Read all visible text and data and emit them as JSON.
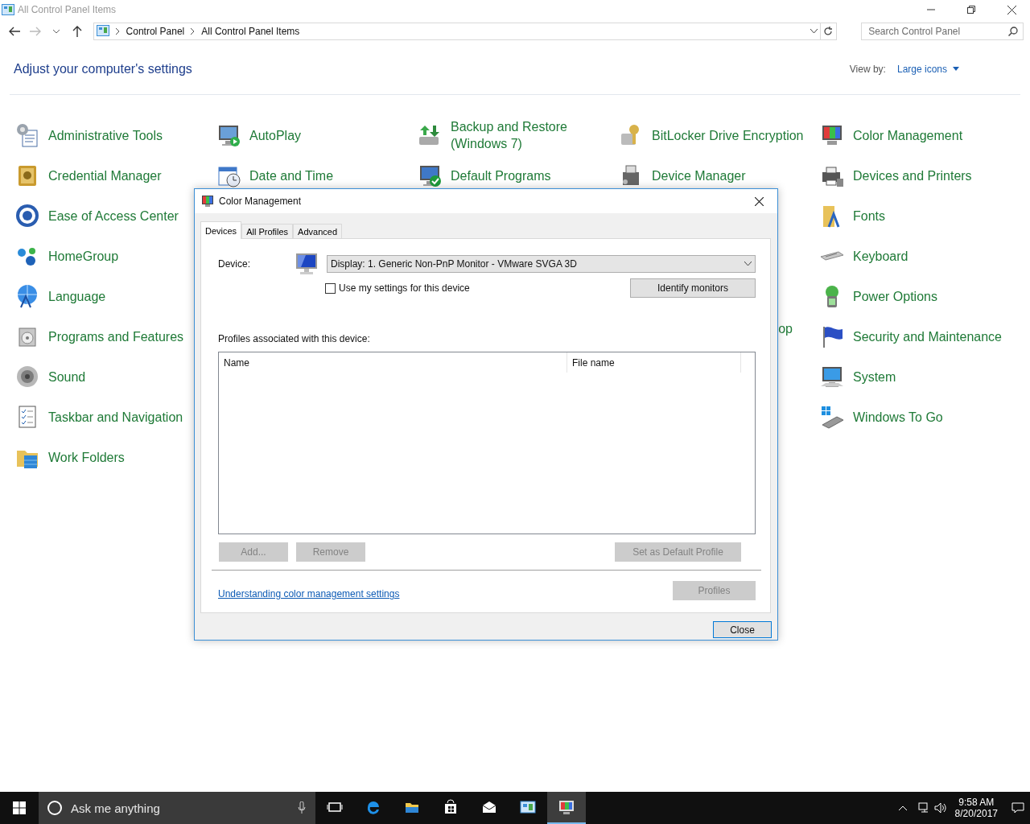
{
  "window": {
    "title": "All Control Panel Items"
  },
  "address_bar": {
    "crumbs": [
      "Control Panel",
      "All Control Panel Items"
    ]
  },
  "search": {
    "placeholder": "Search Control Panel"
  },
  "heading": "Adjust your computer's settings",
  "view_by": {
    "label": "View by:",
    "value": "Large icons"
  },
  "columns": [
    {
      "items": [
        "Administrative Tools",
        "Credential Manager",
        "Ease of Access Center",
        "HomeGroup",
        "Language",
        "Programs and Features",
        "Sound",
        "Taskbar and Navigation",
        "Work Folders"
      ]
    },
    {
      "items": [
        "AutoPlay",
        "Date and Time"
      ]
    },
    {
      "items": [
        "Backup and Restore (Windows 7)",
        "Default Programs"
      ]
    },
    {
      "items": [
        "BitLocker Drive Encryption",
        "Device Manager"
      ]
    },
    {
      "items": [
        "Color Management",
        "Devices and Printers",
        "Fonts",
        "Keyboard",
        "Power Options",
        "Security and Maintenance",
        "System",
        "Windows To Go"
      ]
    }
  ],
  "partial_label": "op",
  "dialog": {
    "title": "Color Management",
    "tabs": [
      {
        "label": "Devices",
        "selected": true
      },
      {
        "label": "All Profiles",
        "selected": false
      },
      {
        "label": "Advanced",
        "selected": false
      }
    ],
    "device_label": "Device:",
    "device_value": "Display: 1. Generic Non-PnP Monitor - VMware SVGA 3D",
    "use_my_settings": {
      "label": "Use my settings for this device",
      "checked": false
    },
    "identify_button": "Identify monitors",
    "profiles_label": "Profiles associated with this device:",
    "list_columns": [
      "Name",
      "File name"
    ],
    "buttons": [
      {
        "label": "Add...",
        "disabled": true
      },
      {
        "label": "Remove",
        "disabled": true
      },
      {
        "label": "Set as Default Profile",
        "disabled": true
      }
    ],
    "link": "Understanding color management settings",
    "profiles_button": {
      "label": "Profiles",
      "disabled": true
    },
    "close_button": "Close"
  },
  "taskbar": {
    "search_placeholder": "Ask me anything",
    "apps": [
      {
        "selected": false
      },
      {
        "selected": false
      },
      {
        "selected": false
      },
      {
        "selected": false
      },
      {
        "selected": false
      },
      {
        "selected": true
      }
    ],
    "time": "9:58 AM",
    "date": "8/20/2017"
  }
}
